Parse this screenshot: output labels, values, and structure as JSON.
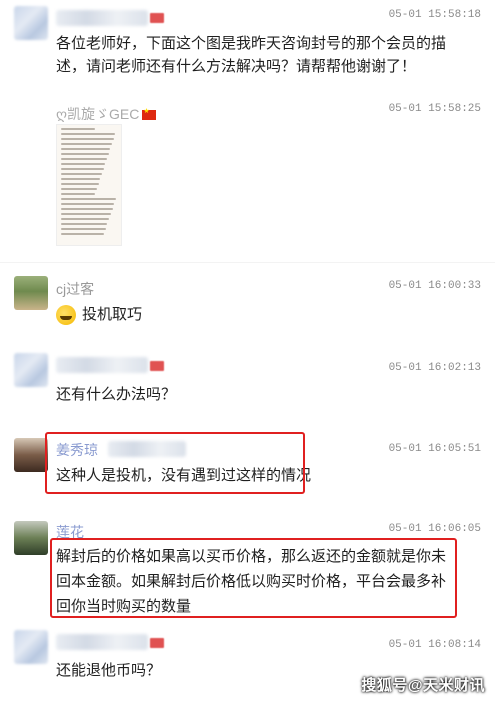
{
  "messages": [
    {
      "id": "m1",
      "sender": "",
      "time": "05-01 15:58:18",
      "text": "各位老师好，下面这个图是我昨天咨询封号的那个会员的描述，请问老师还有什么方法解决吗？请帮帮他谢谢了！"
    },
    {
      "id": "m2",
      "sender": "ღ凯旋ゞGEC",
      "time": "05-01 15:58:25",
      "image_lines": 22
    },
    {
      "id": "m3",
      "sender": "cj过客",
      "time": "05-01 16:00:33",
      "text": "投机取巧",
      "emoji": "grinning-face"
    },
    {
      "id": "m4",
      "sender": "",
      "time": "05-01 16:02:13",
      "text": "还有什么办法吗？"
    },
    {
      "id": "m5",
      "sender": "姜秀琼",
      "time": "05-01 16:05:51",
      "text": "这种人是投机，没有遇到过这样的情况"
    },
    {
      "id": "m6",
      "sender": "莲花",
      "time": "05-01 16:06:05",
      "text": "解封后的价格如果高以买币价格，那么返还的金额就是你未回本金额。如果解封后价格低以购买时价格，平台会最多补回你当时购买的数量"
    },
    {
      "id": "m7",
      "sender": "",
      "time": "05-01 16:08:14",
      "text": "还能退他币吗？"
    }
  ],
  "watermark": "搜狐号@天米财讯",
  "colors": {
    "highlight": "#e02020",
    "time": "#8a8a8a",
    "name": "#666666"
  }
}
